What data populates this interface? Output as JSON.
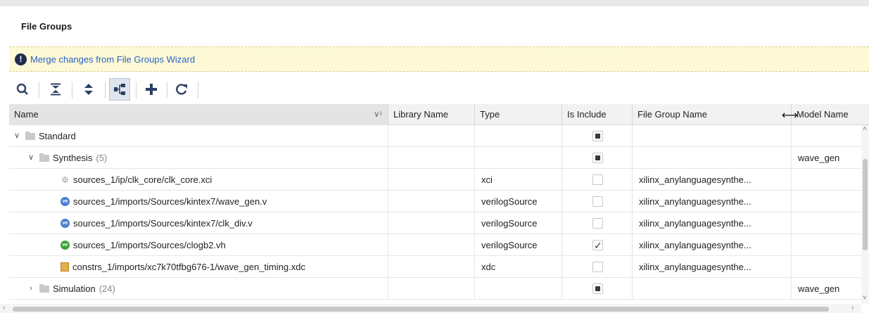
{
  "panel": {
    "title": "File Groups"
  },
  "banner": {
    "link_text": "Merge changes from File Groups Wizard",
    "icon": "info-icon"
  },
  "toolbar": {
    "buttons": [
      {
        "name": "search-icon"
      },
      {
        "name": "collapse-all-icon"
      },
      {
        "name": "expand-all-icon"
      },
      {
        "name": "hierarchy-icon"
      },
      {
        "name": "add-icon"
      },
      {
        "name": "refresh-icon"
      }
    ]
  },
  "table": {
    "columns": [
      "Name",
      "Library Name",
      "Type",
      "Is Include",
      "File Group Name",
      "Model Name"
    ],
    "sort_indicator": "∨¹",
    "rows": [
      {
        "name": "Standard",
        "count": "",
        "lib": "",
        "type": "",
        "include": "partial",
        "file_group": "",
        "model": ""
      },
      {
        "name": "Synthesis",
        "count": "(5)",
        "lib": "",
        "type": "",
        "include": "partial",
        "file_group": "",
        "model": "wave_gen"
      },
      {
        "name": "sources_1/ip/clk_core/clk_core.xci",
        "count": "",
        "lib": "",
        "type": "xci",
        "include": "unchecked",
        "file_group": "xilinx_anylanguagesynthe...",
        "model": ""
      },
      {
        "name": "sources_1/imports/Sources/kintex7/wave_gen.v",
        "count": "",
        "lib": "",
        "type": "verilogSource",
        "include": "unchecked",
        "file_group": "xilinx_anylanguagesynthe...",
        "model": ""
      },
      {
        "name": "sources_1/imports/Sources/kintex7/clk_div.v",
        "count": "",
        "lib": "",
        "type": "verilogSource",
        "include": "unchecked",
        "file_group": "xilinx_anylanguagesynthe...",
        "model": ""
      },
      {
        "name": "sources_1/imports/Sources/clogb2.vh",
        "count": "",
        "lib": "",
        "type": "verilogSource",
        "include": "checked",
        "file_group": "xilinx_anylanguagesynthe...",
        "model": ""
      },
      {
        "name": "constrs_1/imports/xc7k70tfbg676-1/wave_gen_timing.xdc",
        "count": "",
        "lib": "",
        "type": "xdc",
        "include": "unchecked",
        "file_group": "xilinx_anylanguagesynthe...",
        "model": ""
      },
      {
        "name": "Simulation",
        "count": "(24)",
        "lib": "",
        "type": "",
        "include": "partial",
        "file_group": "",
        "model": "wave_gen"
      }
    ]
  },
  "colors": {
    "banner_bg": "#fdf9d6",
    "link": "#2b62c8",
    "header_bg": "#f2f2f2"
  }
}
